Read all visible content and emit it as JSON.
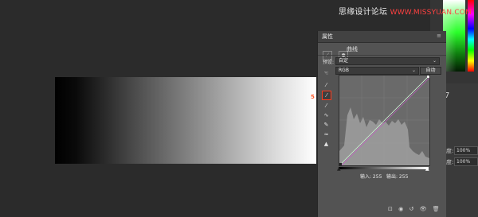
{
  "watermark": {
    "brand": "思缘设计论坛",
    "site": "WWW.MISSYUAN.COM"
  },
  "marker": "5",
  "panel": {
    "title": "属性",
    "menu_icon": "≡",
    "adjustment_name": "曲线",
    "preset_label": "预设:",
    "preset_value": "自定",
    "channel_value": "RGB",
    "auto_label": "自动",
    "input_label": "输入: 255",
    "output_label": "输出: 255",
    "tools": [
      "target-adjust-icon",
      "eyedropper-black-icon",
      "eyedropper-gray-icon",
      "eyedropper-white-icon",
      "curve-point-icon",
      "pencil-icon",
      "smooth-icon",
      "clip-warning-icon"
    ]
  },
  "right_panel": {
    "number": "7",
    "opacity_label": "度:",
    "opacity_value": "100%",
    "fill_label": "度:",
    "fill_value": "100%"
  },
  "colors": {
    "accent": "#ff3c1e",
    "panel_bg": "#535353"
  }
}
